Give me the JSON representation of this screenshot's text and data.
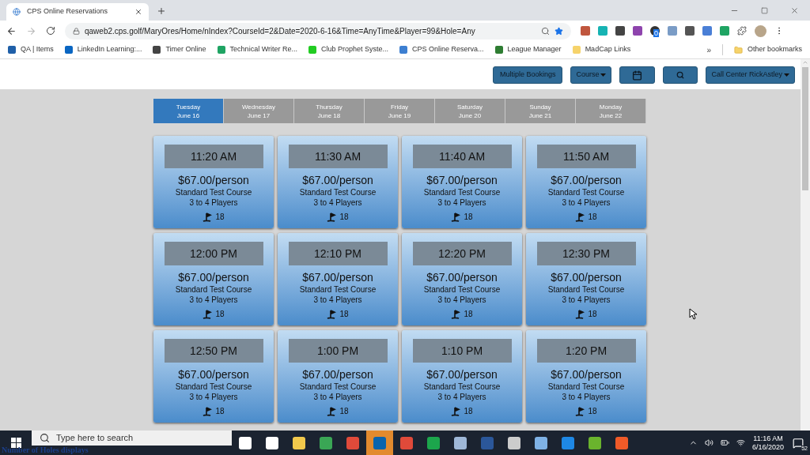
{
  "browser": {
    "tab_title": "CPS Online Reservations",
    "url": "qaweb2.cps.golf/MaryOres/Home/nIndex?CourseId=2&Date=2020-6-16&Time=AnyTime&Player=99&Hole=Any",
    "extension_badge": "0",
    "bookmarks": [
      {
        "label": "QA | Items",
        "color": "#1f5fa8"
      },
      {
        "label": "LinkedIn Learning:...",
        "color": "#0a66c2"
      },
      {
        "label": "Timer Online",
        "color": "#444444"
      },
      {
        "label": "Technical Writer Re...",
        "color": "#1fa463"
      },
      {
        "label": "Club Prophet Syste...",
        "color": "#22cc22"
      },
      {
        "label": "CPS Online Reserva...",
        "color": "#3d7fd1"
      },
      {
        "label": "League Manager",
        "color": "#2e7d32"
      },
      {
        "label": "MadCap Links",
        "color": "#f6d36b"
      }
    ],
    "overflow": "»",
    "other_bookmarks": "Other bookmarks"
  },
  "header": {
    "buttons": [
      {
        "kind": "text",
        "label": "Multiple Bookings"
      },
      {
        "kind": "dropdown",
        "label": "Course"
      },
      {
        "kind": "calendar"
      },
      {
        "kind": "search"
      },
      {
        "kind": "dropdown",
        "label": "Call Center RickAstley"
      }
    ]
  },
  "days": [
    {
      "weekday": "Tuesday",
      "date": "June 16",
      "selected": true
    },
    {
      "weekday": "Wednesday",
      "date": "June 17",
      "selected": false
    },
    {
      "weekday": "Thursday",
      "date": "June 18",
      "selected": false
    },
    {
      "weekday": "Friday",
      "date": "June 19",
      "selected": false
    },
    {
      "weekday": "Saturday",
      "date": "June 20",
      "selected": false
    },
    {
      "weekday": "Sunday",
      "date": "June 21",
      "selected": false
    },
    {
      "weekday": "Monday",
      "date": "June 22",
      "selected": false
    }
  ],
  "tee_times": [
    {
      "time": "11:20 AM",
      "price": "$67.00/person",
      "course": "Standard Test Course",
      "players": "3 to 4 Players",
      "holes": "18"
    },
    {
      "time": "11:30 AM",
      "price": "$67.00/person",
      "course": "Standard Test Course",
      "players": "3 to 4 Players",
      "holes": "18"
    },
    {
      "time": "11:40 AM",
      "price": "$67.00/person",
      "course": "Standard Test Course",
      "players": "3 to 4 Players",
      "holes": "18"
    },
    {
      "time": "11:50 AM",
      "price": "$67.00/person",
      "course": "Standard Test Course",
      "players": "3 to 4 Players",
      "holes": "18"
    },
    {
      "time": "12:00 PM",
      "price": "$67.00/person",
      "course": "Standard Test Course",
      "players": "3 to 4 Players",
      "holes": "18"
    },
    {
      "time": "12:10 PM",
      "price": "$67.00/person",
      "course": "Standard Test Course",
      "players": "3 to 4 Players",
      "holes": "18"
    },
    {
      "time": "12:20 PM",
      "price": "$67.00/person",
      "course": "Standard Test Course",
      "players": "3 to 4 Players",
      "holes": "18"
    },
    {
      "time": "12:30 PM",
      "price": "$67.00/person",
      "course": "Standard Test Course",
      "players": "3 to 4 Players",
      "holes": "18"
    },
    {
      "time": "12:50 PM",
      "price": "$67.00/person",
      "course": "Standard Test Course",
      "players": "3 to 4 Players",
      "holes": "18"
    },
    {
      "time": "1:00 PM",
      "price": "$67.00/person",
      "course": "Standard Test Course",
      "players": "3 to 4 Players",
      "holes": "18"
    },
    {
      "time": "1:10 PM",
      "price": "$67.00/person",
      "course": "Standard Test Course",
      "players": "3 to 4 Players",
      "holes": "18"
    },
    {
      "time": "1:20 PM",
      "price": "$67.00/person",
      "course": "Standard Test Course",
      "players": "3 to 4 Players",
      "holes": "18"
    }
  ],
  "taskbar": {
    "search_placeholder": "Type here to search",
    "time": "11:16 AM",
    "date": "6/16/2020",
    "notifications": "52",
    "apps": [
      {
        "color": "#ffffff",
        "active": false
      },
      {
        "color": "#ffffff",
        "active": false
      },
      {
        "color": "#f2c94c",
        "active": false
      },
      {
        "color": "#3aa655",
        "active": false
      },
      {
        "color": "#e04a3a",
        "active": false
      },
      {
        "color": "#0a64ad",
        "active": true
      },
      {
        "color": "#e04a3a",
        "active": false
      },
      {
        "color": "#1ca64c",
        "active": false
      },
      {
        "color": "#9fb8d8",
        "active": false
      },
      {
        "color": "#2b579a",
        "active": false
      },
      {
        "color": "#cccccc",
        "active": false
      },
      {
        "color": "#7fb2e5",
        "active": false
      },
      {
        "color": "#1e88e5",
        "active": false
      },
      {
        "color": "#6ab42d",
        "active": false
      },
      {
        "color": "#f05a28",
        "active": false
      }
    ]
  },
  "caption": "Number of Holes displays"
}
